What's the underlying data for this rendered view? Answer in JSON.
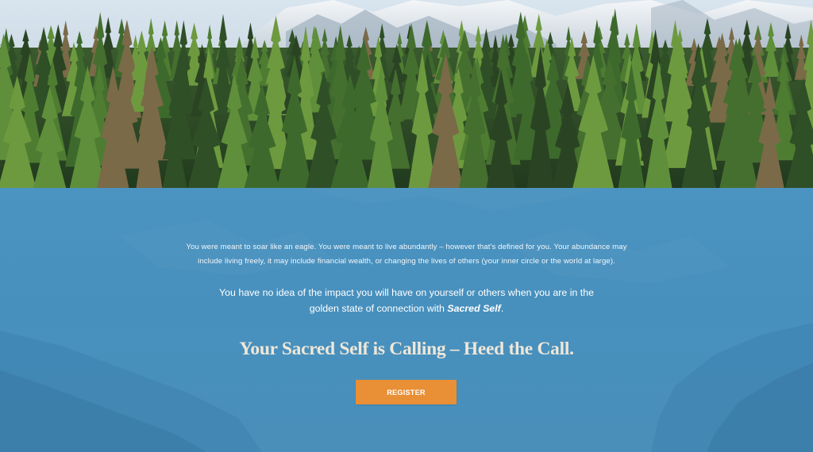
{
  "hero": {
    "image": "mountain-forest-photo"
  },
  "content": {
    "intro_line1": "You were meant to soar like an eagle. You were meant to live abundantly – however that's defined for you. Your abundance may",
    "intro_line2": "include living freely, it may include financial wealth, or changing the lives of others (your inner circle or the world at large).",
    "impact_line1": "You have no idea of the impact you will have on yourself or others when you are in the",
    "impact_line2_prefix": "golden state of connection with ",
    "impact_emphasis": "Sacred Self",
    "impact_line2_suffix": ".",
    "heading": "Your Sacred Self is Calling – Heed the Call.",
    "register_label": "REGISTER"
  },
  "colors": {
    "section_blue": "#4a8fbd",
    "button_orange": "#e98f35",
    "heading_cream": "#efe7d8"
  }
}
